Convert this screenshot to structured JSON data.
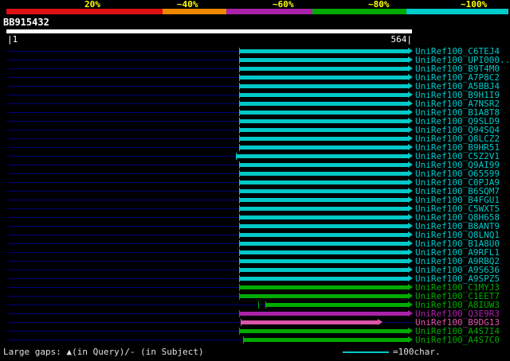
{
  "title": "BB915432",
  "scale": {
    "segments": [
      {
        "label": "20%",
        "color": "#dd1111"
      },
      {
        "label": "~40%",
        "color": "#ee8800"
      },
      {
        "label": "~60%",
        "color": "#aa22aa"
      },
      {
        "label": "~80%",
        "color": "#00aa00"
      },
      {
        "label": "~100%",
        "color": "#00cccc"
      }
    ]
  },
  "ruler": {
    "start_label": "|1",
    "end_label": "564|"
  },
  "footer": {
    "gaps_note": "Large gaps: ▲(in Query)/- (in Subject)",
    "legend_text": "=100char.",
    "legend_line_color": "#00c8c8"
  },
  "chart_data": {
    "type": "bar",
    "subtype": "blast-alignment-graphic-overview",
    "title": "BB915432",
    "query_length": 564,
    "xlim": [
      1,
      564
    ],
    "orientation": "horizontal",
    "identity_colors": {
      "cyan": "#00c8c8",
      "green": "#00aa00",
      "purple": "#aa22aa",
      "magenta": "#dd55aa"
    },
    "identity_scale_meaning": {
      "red": "20%",
      "orange": "~40%",
      "purple": "~60%",
      "green": "~80%",
      "cyan": "~100%"
    },
    "rows": [
      {
        "label": "UniRef100_C6TEJ4",
        "color": "cyan",
        "start": 324,
        "end": 558,
        "gap_ticks": []
      },
      {
        "label": "UniRef100_UPI000..",
        "color": "cyan",
        "start": 324,
        "end": 558,
        "gap_ticks": []
      },
      {
        "label": "UniRef100_B9T4M0",
        "color": "cyan",
        "start": 324,
        "end": 558,
        "gap_ticks": []
      },
      {
        "label": "UniRef100_A7P8C2",
        "color": "cyan",
        "start": 324,
        "end": 558,
        "gap_ticks": []
      },
      {
        "label": "UniRef100_A5BBJ4",
        "color": "cyan",
        "start": 324,
        "end": 558,
        "gap_ticks": []
      },
      {
        "label": "UniRef100_B9H1I9",
        "color": "cyan",
        "start": 324,
        "end": 558,
        "gap_ticks": []
      },
      {
        "label": "UniRef100_A7NSR2",
        "color": "cyan",
        "start": 324,
        "end": 558,
        "gap_ticks": []
      },
      {
        "label": "UniRef100_B1A8T8",
        "color": "cyan",
        "start": 324,
        "end": 558,
        "gap_ticks": []
      },
      {
        "label": "UniRef100_Q9SLD9",
        "color": "cyan",
        "start": 324,
        "end": 558,
        "gap_ticks": []
      },
      {
        "label": "UniRef100_Q94SQ4",
        "color": "cyan",
        "start": 324,
        "end": 558,
        "gap_ticks": []
      },
      {
        "label": "UniRef100_Q8LCZ2",
        "color": "cyan",
        "start": 324,
        "end": 558,
        "gap_ticks": []
      },
      {
        "label": "UniRef100_B9HR51",
        "color": "cyan",
        "start": 324,
        "end": 558,
        "gap_ticks": []
      },
      {
        "label": "UniRef100_C5Z2V1",
        "color": "cyan",
        "start": 320,
        "end": 558,
        "gap_ticks": []
      },
      {
        "label": "UniRef100_Q9AI99",
        "color": "cyan",
        "start": 324,
        "end": 558,
        "gap_ticks": []
      },
      {
        "label": "UniRef100_O65599",
        "color": "cyan",
        "start": 324,
        "end": 558,
        "gap_ticks": []
      },
      {
        "label": "UniRef100_C0PJA9",
        "color": "cyan",
        "start": 324,
        "end": 558,
        "gap_ticks": []
      },
      {
        "label": "UniRef100_B6SQM7",
        "color": "cyan",
        "start": 324,
        "end": 558,
        "gap_ticks": []
      },
      {
        "label": "UniRef100_B4FGU1",
        "color": "cyan",
        "start": 324,
        "end": 558,
        "gap_ticks": []
      },
      {
        "label": "UniRef100_C5WXT5",
        "color": "cyan",
        "start": 324,
        "end": 558,
        "gap_ticks": []
      },
      {
        "label": "UniRef100_Q8H658",
        "color": "cyan",
        "start": 324,
        "end": 558,
        "gap_ticks": []
      },
      {
        "label": "UniRef100_B8ANT9",
        "color": "cyan",
        "start": 324,
        "end": 558,
        "gap_ticks": []
      },
      {
        "label": "UniRef100_Q8LNQ1",
        "color": "cyan",
        "start": 324,
        "end": 558,
        "gap_ticks": []
      },
      {
        "label": "UniRef100_B1A8U0",
        "color": "cyan",
        "start": 324,
        "end": 558,
        "gap_ticks": []
      },
      {
        "label": "UniRef100_A9RFL1",
        "color": "cyan",
        "start": 324,
        "end": 558,
        "gap_ticks": []
      },
      {
        "label": "UniRef100_A9RBQ2",
        "color": "cyan",
        "start": 324,
        "end": 558,
        "gap_ticks": []
      },
      {
        "label": "UniRef100_A9S636",
        "color": "cyan",
        "start": 324,
        "end": 558,
        "gap_ticks": []
      },
      {
        "label": "UniRef100_A9SPZ5",
        "color": "cyan",
        "start": 324,
        "end": 558,
        "gap_ticks": []
      },
      {
        "label": "UniRef100_C1MYJ3",
        "color": "green",
        "start": 324,
        "end": 558,
        "gap_ticks": []
      },
      {
        "label": "UniRef100_C1EET7",
        "color": "green",
        "start": 324,
        "end": 558,
        "gap_ticks": []
      },
      {
        "label": "UniRef100_A8IUW3",
        "color": "green",
        "start": 360,
        "end": 558,
        "gap_ticks": [
          350
        ]
      },
      {
        "label": "UniRef100_Q3E9R3",
        "color": "purple",
        "start": 324,
        "end": 558,
        "gap_ticks": []
      },
      {
        "label": "UniRef100_B9DG13",
        "color": "magenta",
        "start": 326,
        "end": 516,
        "gap_ticks": []
      },
      {
        "label": "UniRef100_A4S7I4",
        "color": "green",
        "start": 324,
        "end": 558,
        "gap_ticks": []
      },
      {
        "label": "UniRef100_A4S7C0",
        "color": "green",
        "start": 330,
        "end": 558,
        "gap_ticks": []
      }
    ]
  }
}
